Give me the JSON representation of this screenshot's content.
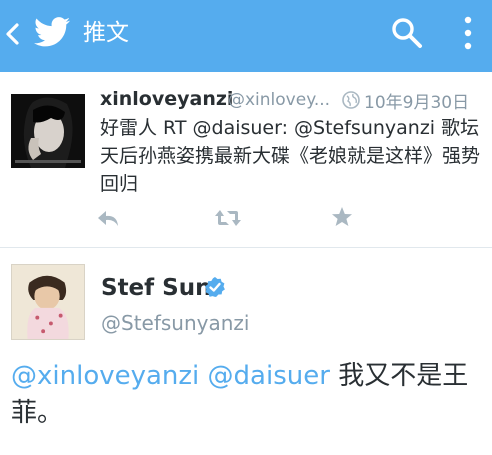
{
  "header": {
    "title": "推文",
    "bg_color": "#55acee"
  },
  "tweet1": {
    "name": "xinloveyanzi",
    "handle": "@xinlovey...",
    "date": "10年9月30日",
    "text": "好雷人 RT @daisuer: @Stefsunyanzi 歌坛天后孙燕姿携最新大碟《老娘就是这样》强势回归",
    "icons": [
      "reply-icon",
      "retweet-icon",
      "favorite-icon",
      "globe-icon"
    ]
  },
  "tweet2": {
    "name": "Stef Sun",
    "handle": "@Stefsunyanzi",
    "mention1": "@xinloveyanzi",
    "mention2": "@daisuer",
    "text_rest": "我又不是王菲。"
  },
  "colors": {
    "accent": "#55acee",
    "muted": "#8899a6",
    "text": "#292f33",
    "action_icon": "#aab8c2"
  }
}
